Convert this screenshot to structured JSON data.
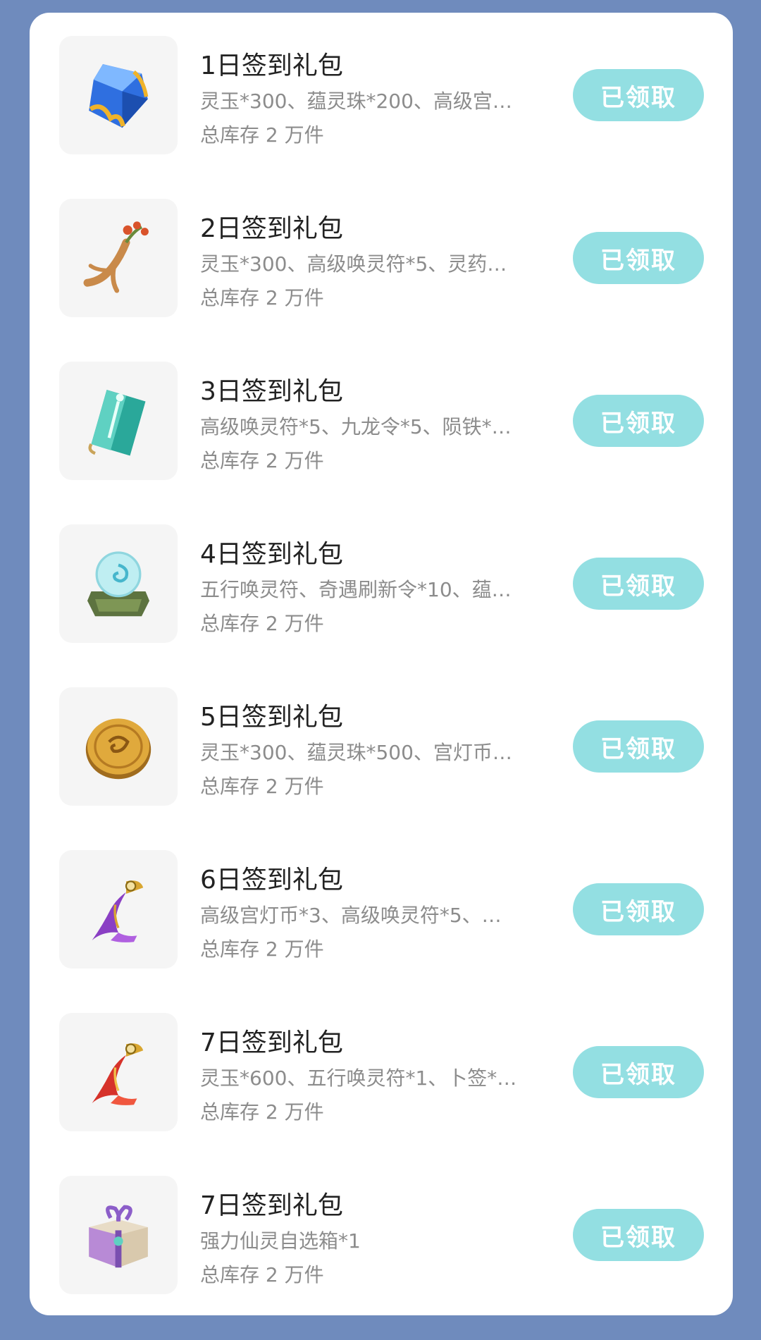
{
  "colors": {
    "background": "#6f8bbd",
    "card": "#ffffff",
    "button": "#93dfe2",
    "title": "#222222",
    "muted": "#8c8c8c"
  },
  "packages": [
    {
      "icon": "blue-gem-icon",
      "title": "1日签到礼包",
      "desc": "灵玉*300、蕴灵珠*200、高级宫…",
      "stock": "总库存 2 万件",
      "button": "已领取"
    },
    {
      "icon": "ginseng-root-icon",
      "title": "2日签到礼包",
      "desc": "灵玉*300、高级唤灵符*5、灵药…",
      "stock": "总库存 2 万件",
      "button": "已领取"
    },
    {
      "icon": "talisman-scroll-icon",
      "title": "3日签到礼包",
      "desc": "高级唤灵符*5、九龙令*5、陨铁*…",
      "stock": "总库存 2 万件",
      "button": "已领取"
    },
    {
      "icon": "crystal-orb-icon",
      "title": "4日签到礼包",
      "desc": "五行唤灵符、奇遇刷新令*10、蕴…",
      "stock": "总库存 2 万件",
      "button": "已领取"
    },
    {
      "icon": "gold-coin-icon",
      "title": "5日签到礼包",
      "desc": "灵玉*300、蕴灵珠*500、宫灯币…",
      "stock": "总库存 2 万件",
      "button": "已领取"
    },
    {
      "icon": "purple-scroll-icon",
      "title": "6日签到礼包",
      "desc": "高级宫灯币*3、高级唤灵符*5、…",
      "stock": "总库存 2 万件",
      "button": "已领取"
    },
    {
      "icon": "red-scroll-icon",
      "title": "7日签到礼包",
      "desc": "灵玉*600、五行唤灵符*1、卜签*…",
      "stock": "总库存 2 万件",
      "button": "已领取"
    },
    {
      "icon": "gift-box-icon",
      "title": "7日签到礼包",
      "desc": "强力仙灵自选箱*1",
      "stock": "总库存 2 万件",
      "button": "已领取"
    }
  ]
}
